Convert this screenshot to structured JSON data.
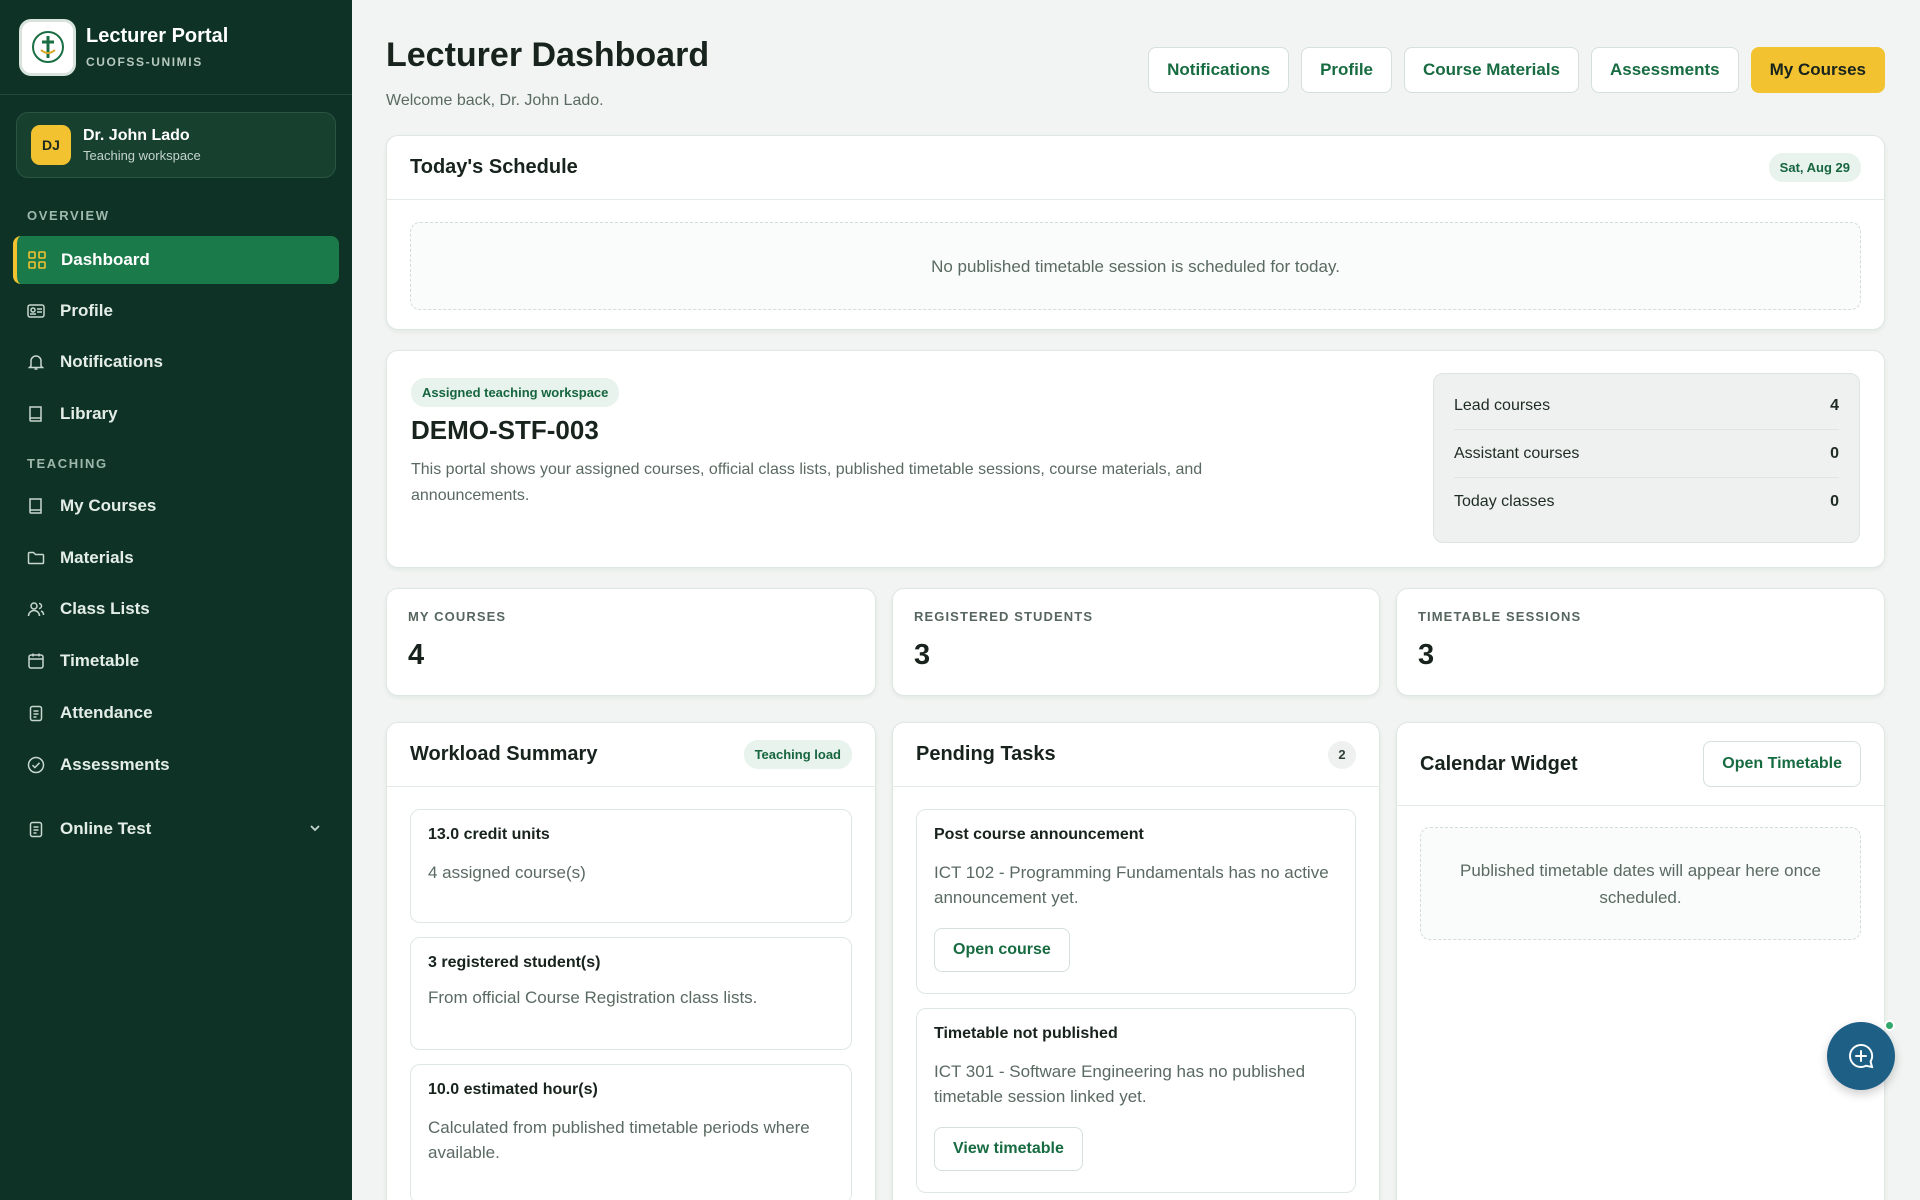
{
  "brand": {
    "title": "Lecturer Portal",
    "subtitle": "CUOFSS-UNIMIS"
  },
  "user": {
    "initials": "DJ",
    "name": "Dr. John Lado",
    "role": "Teaching workspace"
  },
  "sidebar": {
    "sections": [
      "OVERVIEW",
      "TEACHING"
    ],
    "items": [
      {
        "label": "Dashboard",
        "icon": "grid-icon"
      },
      {
        "label": "Profile",
        "icon": "id-card-icon"
      },
      {
        "label": "Notifications",
        "icon": "bell-icon"
      },
      {
        "label": "Library",
        "icon": "book-icon"
      },
      {
        "label": "My Courses",
        "icon": "book-icon"
      },
      {
        "label": "Materials",
        "icon": "folder-icon"
      },
      {
        "label": "Class Lists",
        "icon": "users-icon"
      },
      {
        "label": "Timetable",
        "icon": "calendar-icon"
      },
      {
        "label": "Attendance",
        "icon": "clipboard-icon"
      },
      {
        "label": "Assessments",
        "icon": "check-circle-icon"
      },
      {
        "label": "Online Test",
        "icon": "clipboard-icon"
      }
    ]
  },
  "header": {
    "title": "Lecturer Dashboard",
    "subtitle": "Welcome back, Dr. John Lado.",
    "actions": [
      "Notifications",
      "Profile",
      "Course Materials",
      "Assessments",
      "My Courses"
    ]
  },
  "schedule": {
    "title": "Today's Schedule",
    "date": "Sat, Aug 29",
    "empty": "No published timetable session is scheduled for today."
  },
  "workspace": {
    "tag": "Assigned teaching workspace",
    "code": "DEMO-STF-003",
    "description": "This portal shows your assigned courses, official class lists, published timetable sessions, course materials, and announcements.",
    "stats": [
      {
        "label": "Lead courses",
        "value": "4"
      },
      {
        "label": "Assistant courses",
        "value": "0"
      },
      {
        "label": "Today classes",
        "value": "0"
      }
    ]
  },
  "metrics": [
    {
      "label": "MY COURSES",
      "value": "4"
    },
    {
      "label": "REGISTERED STUDENTS",
      "value": "3"
    },
    {
      "label": "TIMETABLE SESSIONS",
      "value": "3"
    }
  ],
  "workload": {
    "title": "Workload Summary",
    "badge": "Teaching load",
    "items": [
      {
        "title": "13.0 credit units",
        "text": "4 assigned course(s)"
      },
      {
        "title": "3 registered student(s)",
        "text": "From official Course Registration class lists."
      },
      {
        "title": "10.0 estimated hour(s)",
        "text": "Calculated from published timetable periods where available."
      }
    ]
  },
  "tasks": {
    "title": "Pending Tasks",
    "count": "2",
    "items": [
      {
        "title": "Post course announcement",
        "text": "ICT 102 - Programming Fundamentals has no active announcement yet.",
        "action": "Open course"
      },
      {
        "title": "Timetable not published",
        "text": "ICT 301 - Software Engineering has no published timetable session linked yet.",
        "action": "View timetable"
      }
    ]
  },
  "calendar": {
    "title": "Calendar Widget",
    "action": "Open Timetable",
    "empty": "Published timetable dates will appear here once scheduled."
  },
  "colors": {
    "sidebar_bg": "#0e3326",
    "active_nav": "#1b7a4a",
    "accent_yellow": "#f2c230",
    "brand_green": "#176b41",
    "fab_blue": "#1e5f86"
  }
}
